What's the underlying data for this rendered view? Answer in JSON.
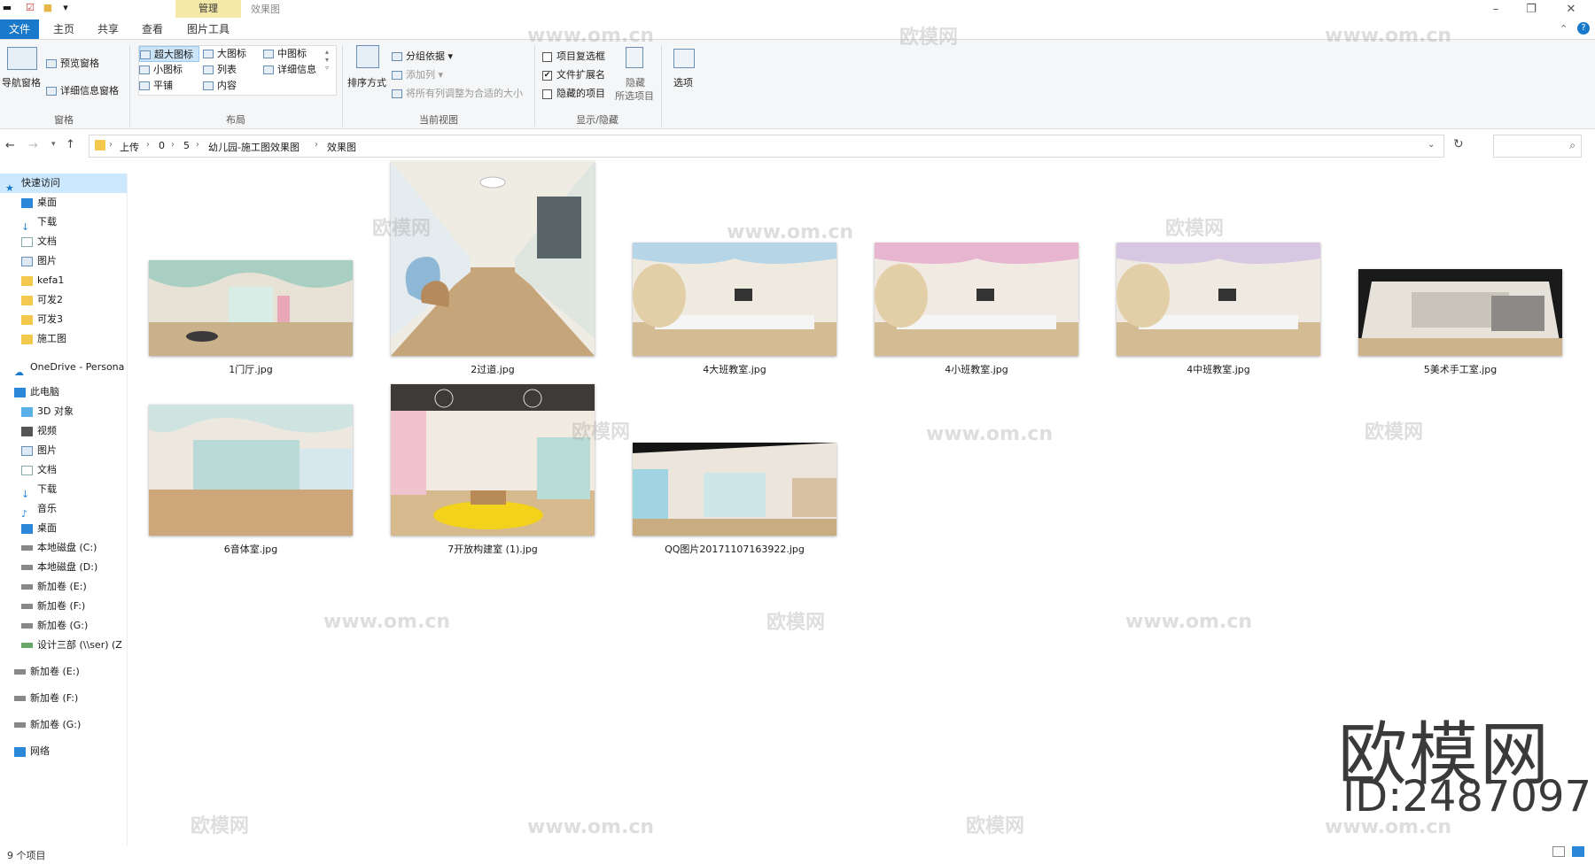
{
  "titlebar": {
    "context_tab": "管理",
    "title": "效果图"
  },
  "tabs": [
    {
      "label": "文件"
    },
    {
      "label": "主页"
    },
    {
      "label": "共享"
    },
    {
      "label": "查看"
    },
    {
      "label": "图片工具"
    }
  ],
  "ribbon": {
    "pane": {
      "nav_pane": "导航窗格",
      "preview_pane": "预览窗格",
      "details_pane": "详细信息窗格",
      "group": "窗格"
    },
    "layout": {
      "items": [
        "超大图标",
        "大图标",
        "中图标",
        "小图标",
        "列表",
        "详细信息",
        "平铺",
        "内容"
      ],
      "group": "布局"
    },
    "current_view": {
      "sort": "排序方式",
      "group_by": "分组依据",
      "add_columns": "添加列",
      "fit_columns": "将所有列调整为合适的大小",
      "group": "当前视图"
    },
    "show_hide": {
      "item_checkboxes": "项目复选框",
      "file_extensions": "文件扩展名",
      "hidden_items": "隐藏的项目",
      "hide_selected": "隐藏",
      "hide_selected_2": "所选项目",
      "group": "显示/隐藏"
    },
    "options": "选项"
  },
  "address": {
    "crumbs": [
      "上传",
      "0",
      "5",
      "幼儿园-施工图效果图",
      "效果图"
    ]
  },
  "sidebar": {
    "quick_access": "快速访问",
    "quick_items": [
      "桌面",
      "下载",
      "文档",
      "图片",
      "kefa1",
      "可发2",
      "可发3",
      "施工图"
    ],
    "onedrive": "OneDrive - Persona",
    "this_pc": "此电脑",
    "pc_items": [
      "3D 对象",
      "视频",
      "图片",
      "文档",
      "下载",
      "音乐",
      "桌面",
      "本地磁盘 (C:)",
      "本地磁盘 (D:)",
      "新加卷 (E:)",
      "新加卷 (F:)",
      "新加卷 (G:)",
      "设计三部 (\\\\ser) (Z"
    ],
    "drives": [
      "新加卷 (E:)",
      "新加卷 (F:)",
      "新加卷 (G:)"
    ],
    "network": "网络"
  },
  "files": [
    {
      "name": "1门厅.jpg"
    },
    {
      "name": "2过道.jpg"
    },
    {
      "name": "4大班教室.jpg"
    },
    {
      "name": "4小班教室.jpg"
    },
    {
      "name": "4中班教室.jpg"
    },
    {
      "name": "5美术手工室.jpg"
    },
    {
      "name": "6音体室.jpg"
    },
    {
      "name": "7开放构建室 (1).jpg"
    },
    {
      "name": "QQ图片20171107163922.jpg"
    }
  ],
  "status": {
    "count": "9 个项目"
  },
  "watermark": {
    "site": "www.om.cn",
    "brand": "欧模网",
    "id": "ID:2487097"
  },
  "colors": {
    "accent": "#1979ca",
    "context_tab": "#f5e9a8",
    "selection": "#cce4f7"
  }
}
